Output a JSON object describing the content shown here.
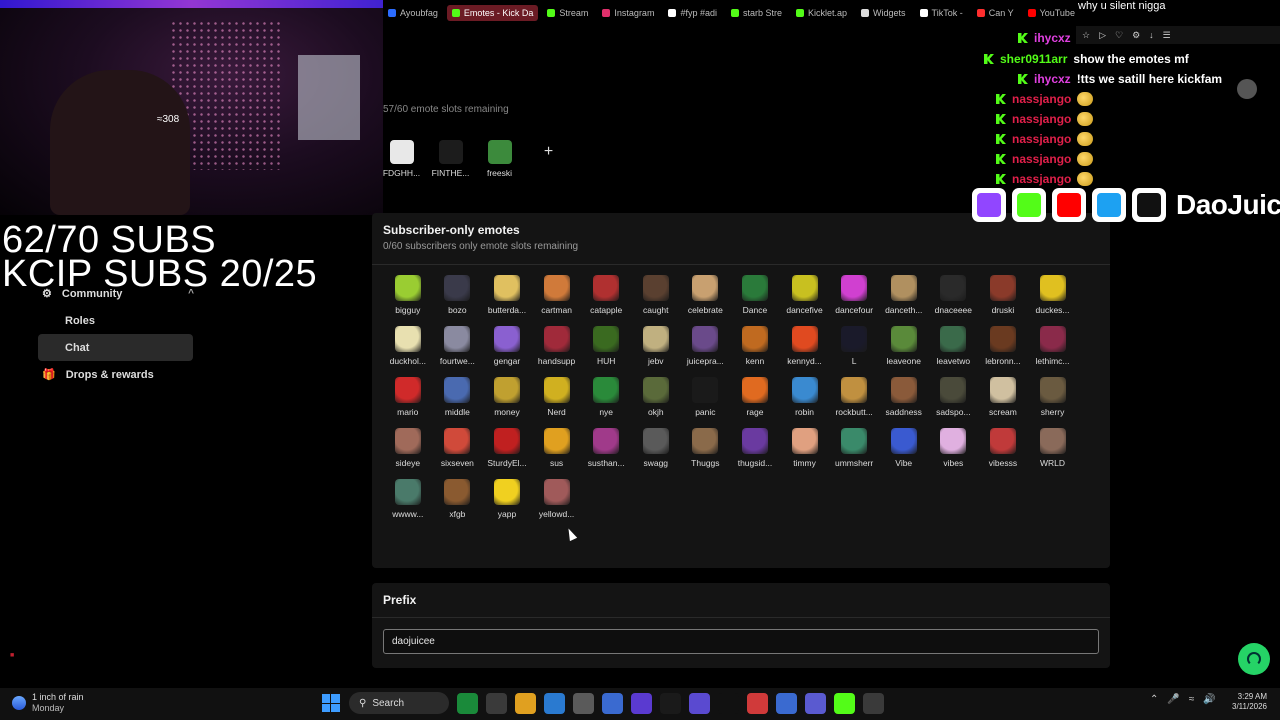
{
  "browser": {
    "tabs": [
      {
        "label": "Ayoubfag",
        "color": "#2b6cff",
        "active": false
      },
      {
        "label": "Emotes - Kick Da",
        "color": "#53fc18",
        "active": true
      },
      {
        "label": "Stream",
        "color": "#53fc18",
        "active": false
      },
      {
        "label": "Instagram",
        "color": "#e1306c",
        "active": false
      },
      {
        "label": "#fyp #adi",
        "color": "#ffffff",
        "active": false
      },
      {
        "label": "starb Stre",
        "color": "#53fc18",
        "active": false
      },
      {
        "label": "Kicklet.ap",
        "color": "#53fc18",
        "active": false
      },
      {
        "label": "Widgets",
        "color": "#dddddd",
        "active": false
      },
      {
        "label": "TikTok -",
        "color": "#ffffff",
        "active": false
      },
      {
        "label": "Can Y",
        "color": "#ff2e2e",
        "active": false
      },
      {
        "label": "YouTube",
        "color": "#ff0000",
        "active": false
      }
    ]
  },
  "webcam": {
    "label": "≈308"
  },
  "overlay": {
    "subs_line1": "62/70 SUBS",
    "subs_line2": "KCIP SUBS 20/25"
  },
  "sidebar": {
    "items": [
      {
        "label": "Community",
        "icon": "community-icon",
        "chevron": "^"
      },
      {
        "label": "Roles",
        "icon": ""
      },
      {
        "label": "Chat",
        "icon": ""
      },
      {
        "label": "Drops & rewards",
        "icon": "gift-icon"
      }
    ]
  },
  "emotes": {
    "slot_note": "57/60 emote slots remaining",
    "regular": [
      {
        "label": "FDGHH...",
        "color": "#e8e8e8"
      },
      {
        "label": "FINTHE...",
        "color": "#1c1c1c"
      },
      {
        "label": "freeski",
        "color": "#3c8a3c"
      }
    ],
    "add_label": "+",
    "subscriber": {
      "title": "Subscriber-only emotes",
      "note": "0/60 subscribers only emote slots remaining",
      "items": [
        {
          "label": "bigguy",
          "color": "#9acd32"
        },
        {
          "label": "bozo",
          "color": "#3a3a4a"
        },
        {
          "label": "butterda...",
          "color": "#e0c060"
        },
        {
          "label": "cartman",
          "color": "#d07a3a"
        },
        {
          "label": "catapple",
          "color": "#b03030"
        },
        {
          "label": "caught",
          "color": "#5a4030"
        },
        {
          "label": "celebrate",
          "color": "#c8a070"
        },
        {
          "label": "Dance",
          "color": "#2a7a3a"
        },
        {
          "label": "dancefive",
          "color": "#c8c020"
        },
        {
          "label": "dancefour",
          "color": "#d040d0"
        },
        {
          "label": "danceth...",
          "color": "#b09060"
        },
        {
          "label": "dnaceeee",
          "color": "#2a2a2a"
        },
        {
          "label": "druski",
          "color": "#8a3a2a"
        },
        {
          "label": "duckes...",
          "color": "#e0c020"
        },
        {
          "label": "duckhol...",
          "color": "#e8e0b0"
        },
        {
          "label": "fourtwe...",
          "color": "#8a8aa0"
        },
        {
          "label": "gengar",
          "color": "#8a60d0"
        },
        {
          "label": "handsupp",
          "color": "#a02a3a"
        },
        {
          "label": "HUH",
          "color": "#3a6a20"
        },
        {
          "label": "jebv",
          "color": "#c0b080"
        },
        {
          "label": "juicepra...",
          "color": "#6a4a8a"
        },
        {
          "label": "kenn",
          "color": "#c06a20"
        },
        {
          "label": "kennyd...",
          "color": "#e04a20"
        },
        {
          "label": "L",
          "color": "#1a1a2a"
        },
        {
          "label": "leaveone",
          "color": "#5a8a3a"
        },
        {
          "label": "leavetwo",
          "color": "#3a6a4a"
        },
        {
          "label": "lebronn...",
          "color": "#6a3a20"
        },
        {
          "label": "lethimc...",
          "color": "#8a2a4a"
        },
        {
          "label": "mario",
          "color": "#d02a2a"
        },
        {
          "label": "middle",
          "color": "#4a6ab0"
        },
        {
          "label": "money",
          "color": "#c0a030"
        },
        {
          "label": "Nerd",
          "color": "#d0b020"
        },
        {
          "label": "nye",
          "color": "#2a8a3a"
        },
        {
          "label": "okjh",
          "color": "#5a6a3a"
        },
        {
          "label": "panic",
          "color": "#1a1a1a"
        },
        {
          "label": "rage",
          "color": "#e06a20"
        },
        {
          "label": "robin",
          "color": "#3a8ad0"
        },
        {
          "label": "rockbutt...",
          "color": "#c09040"
        },
        {
          "label": "saddness",
          "color": "#8a5a3a"
        },
        {
          "label": "sadspo...",
          "color": "#4a4a3a"
        },
        {
          "label": "scream",
          "color": "#d0c0a0"
        },
        {
          "label": "sherry",
          "color": "#6a5a40"
        },
        {
          "label": "sideye",
          "color": "#a06a5a"
        },
        {
          "label": "sixseven",
          "color": "#d04a3a"
        },
        {
          "label": "SturdyEl...",
          "color": "#c02020"
        },
        {
          "label": "sus",
          "color": "#e0a020"
        },
        {
          "label": "susthan...",
          "color": "#a03a8a"
        },
        {
          "label": "swagg",
          "color": "#5a5a5a"
        },
        {
          "label": "Thuggs",
          "color": "#8a6a4a"
        },
        {
          "label": "thugsid...",
          "color": "#6a3aa0"
        },
        {
          "label": "timmy",
          "color": "#e0a080"
        },
        {
          "label": "ummsherr",
          "color": "#3a8a6a"
        },
        {
          "label": "Vibe",
          "color": "#3a5ad0"
        },
        {
          "label": "vibes",
          "color": "#e0b0e0"
        },
        {
          "label": "vibesss",
          "color": "#c03a3a"
        },
        {
          "label": "WRLD",
          "color": "#8a6a5a"
        },
        {
          "label": "wwww...",
          "color": "#4a7a6a"
        },
        {
          "label": "xfgb",
          "color": "#8a5a30"
        },
        {
          "label": "yapp",
          "color": "#f0d020"
        },
        {
          "label": "yellowd...",
          "color": "#a05a5a"
        }
      ]
    }
  },
  "prefix": {
    "title": "Prefix",
    "value": "daojuicee"
  },
  "chat": {
    "top_text": "why u silent nigga",
    "messages": [
      {
        "user": "ihycxz",
        "user_color": "#e040e0",
        "text": "",
        "icons": true
      },
      {
        "user": "sher0911arr",
        "user_color": "#53fc18",
        "text": "show the emotes mf"
      },
      {
        "user": "ihycxz",
        "user_color": "#e040e0",
        "text": "!tts we satill here kickfam"
      },
      {
        "user": "nassjango",
        "user_color": "#e0204a",
        "text": "",
        "emote": true
      },
      {
        "user": "nassjango",
        "user_color": "#e0204a",
        "text": "",
        "emote": true
      },
      {
        "user": "nassjango",
        "user_color": "#e0204a",
        "text": "",
        "emote": true
      },
      {
        "user": "nassjango",
        "user_color": "#e0204a",
        "text": "",
        "emote": true
      },
      {
        "user": "nassjango",
        "user_color": "#e0204a",
        "text": "",
        "emote": true
      }
    ]
  },
  "socials": {
    "brand": "DaoJuice",
    "icons": [
      {
        "name": "twitch-icon",
        "color": "#9146ff"
      },
      {
        "name": "kick-icon",
        "color": "#53fc18"
      },
      {
        "name": "youtube-icon",
        "color": "#ff0000"
      },
      {
        "name": "twitter-icon",
        "color": "#1da1f2"
      },
      {
        "name": "tiktok-icon",
        "color": "#111111"
      }
    ]
  },
  "taskbar": {
    "weather_line1": "1 inch of rain",
    "weather_line2": "Monday",
    "search_label": "Search",
    "time": "3:29 AM",
    "date": "3/11/2026",
    "apps": [
      "#1a8a3a",
      "#3a3a3a",
      "#e0a020",
      "#2a7ad0",
      "#5a5a5a",
      "#3a6ad0",
      "#5a3ad0",
      "#1a1a1a",
      "#5a4ad0",
      "#111111",
      "#d03a3a",
      "#3a6ad0",
      "#5a5ad0",
      "#53fc18",
      "#3a3a3a"
    ]
  }
}
